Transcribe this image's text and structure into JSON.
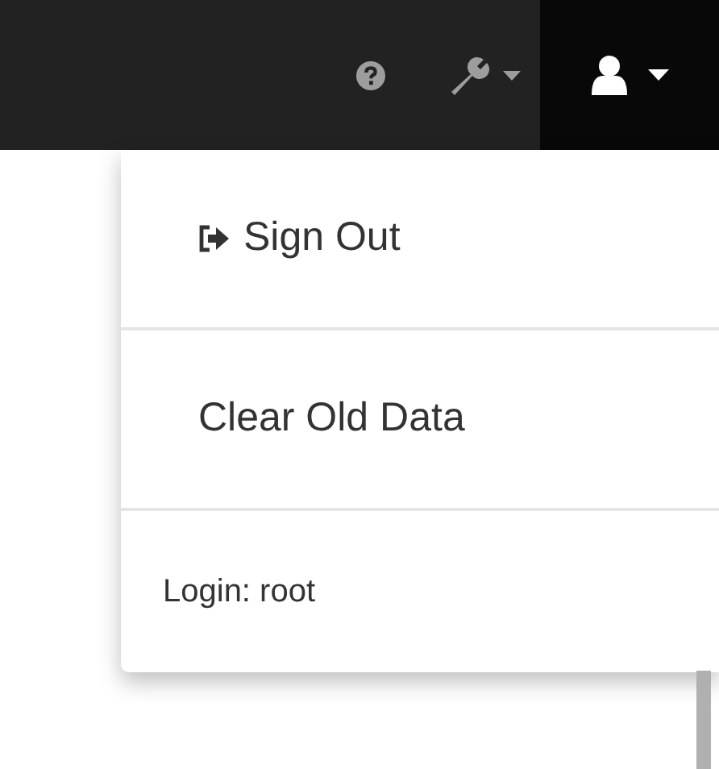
{
  "navbar": {
    "user_menu": {
      "expanded": true
    }
  },
  "dropdown": {
    "items": [
      {
        "kind": "link",
        "label": "Sign Out",
        "icon": true
      },
      {
        "kind": "link",
        "label": "Clear Old Data"
      },
      {
        "kind": "info",
        "label": "Login: root"
      }
    ]
  }
}
